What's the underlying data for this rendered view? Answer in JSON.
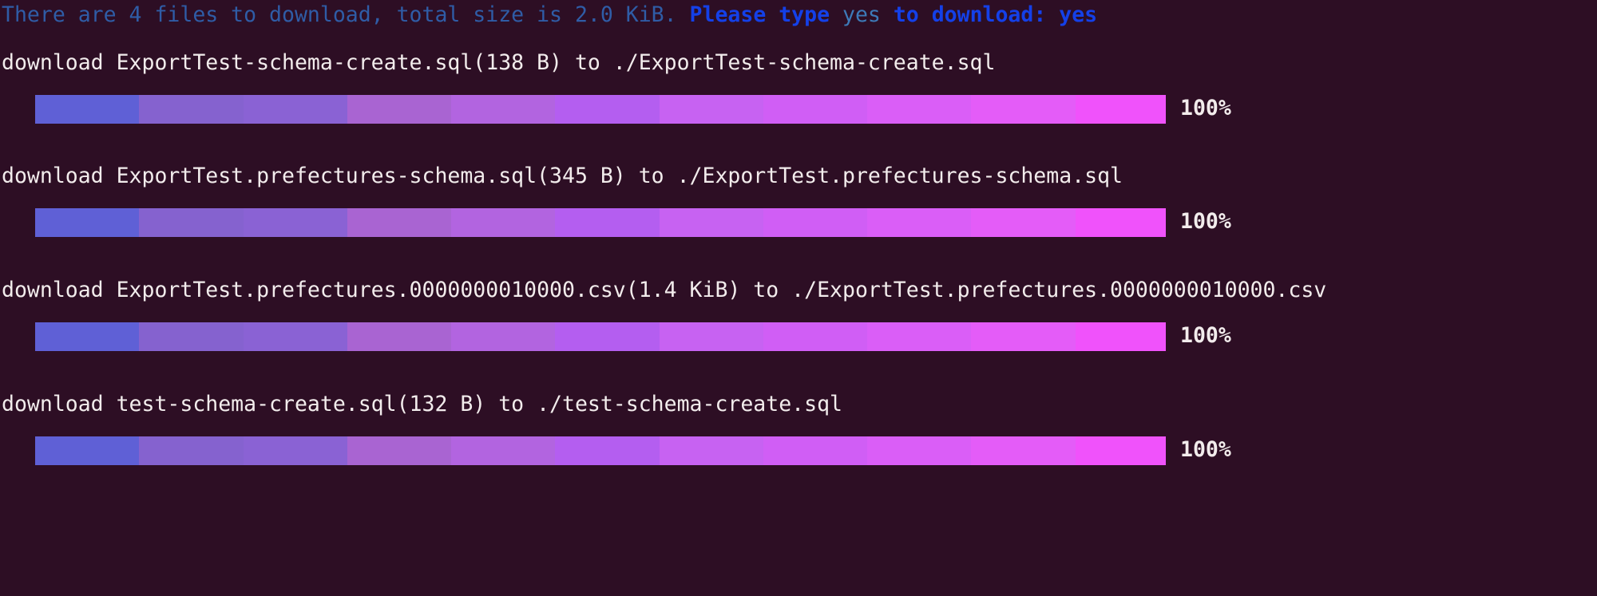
{
  "terminal": {
    "background_color": "#2d0e24",
    "text_color": "#f2ecec"
  },
  "prompt": {
    "part_1": "There are 4 files to download, total size is 2.0 KiB.",
    "part_2": " Please type ",
    "part_3": "yes",
    "part_4": " to download: ",
    "answer": "yes",
    "dim_color": "#2f5ca6",
    "bold_color": "#1440e8",
    "input_color": "#3d7ab8"
  },
  "downloads": [
    {
      "text": "download ExportTest-schema-create.sql(138 B) to ./ExportTest-schema-create.sql",
      "file_name": "ExportTest-schema-create.sql",
      "file_size": "138 B",
      "destination": "./ExportTest-schema-create.sql",
      "percent": "100%",
      "progress": 100
    },
    {
      "text": "download ExportTest.prefectures-schema.sql(345 B) to ./ExportTest.prefectures-schema.sql",
      "file_name": "ExportTest.prefectures-schema.sql",
      "file_size": "345 B",
      "destination": "./ExportTest.prefectures-schema.sql",
      "percent": "100%",
      "progress": 100
    },
    {
      "text": "download ExportTest.prefectures.0000000010000.csv(1.4 KiB) to ./ExportTest.prefectures.0000000010000.csv",
      "file_name": "ExportTest.prefectures.0000000010000.csv",
      "file_size": "1.4 KiB",
      "destination": "./ExportTest.prefectures.0000000010000.csv",
      "percent": "100%",
      "progress": 100
    },
    {
      "text": "download test-schema-create.sql(132 B) to ./test-schema-create.sql",
      "file_name": "test-schema-create.sql",
      "file_size": "132 B",
      "destination": "./test-schema-create.sql",
      "percent": "100%",
      "progress": 100
    }
  ],
  "progress_bar": {
    "segments": [
      {
        "color": "#5f60d6",
        "width": 9.2
      },
      {
        "color": "#8562cf",
        "width": 9.2
      },
      {
        "color": "#8a62d4",
        "width": 9.2
      },
      {
        "color": "#a964d2",
        "width": 9.2
      },
      {
        "color": "#b264e0",
        "width": 9.2
      },
      {
        "color": "#b45ef0",
        "width": 9.2
      },
      {
        "color": "#c762f2",
        "width": 9.2
      },
      {
        "color": "#d05ef5",
        "width": 9.2
      },
      {
        "color": "#da5ef7",
        "width": 9.2
      },
      {
        "color": "#e45cf8",
        "width": 9.2
      },
      {
        "color": "#f052fb",
        "width": 8.0
      }
    ]
  }
}
